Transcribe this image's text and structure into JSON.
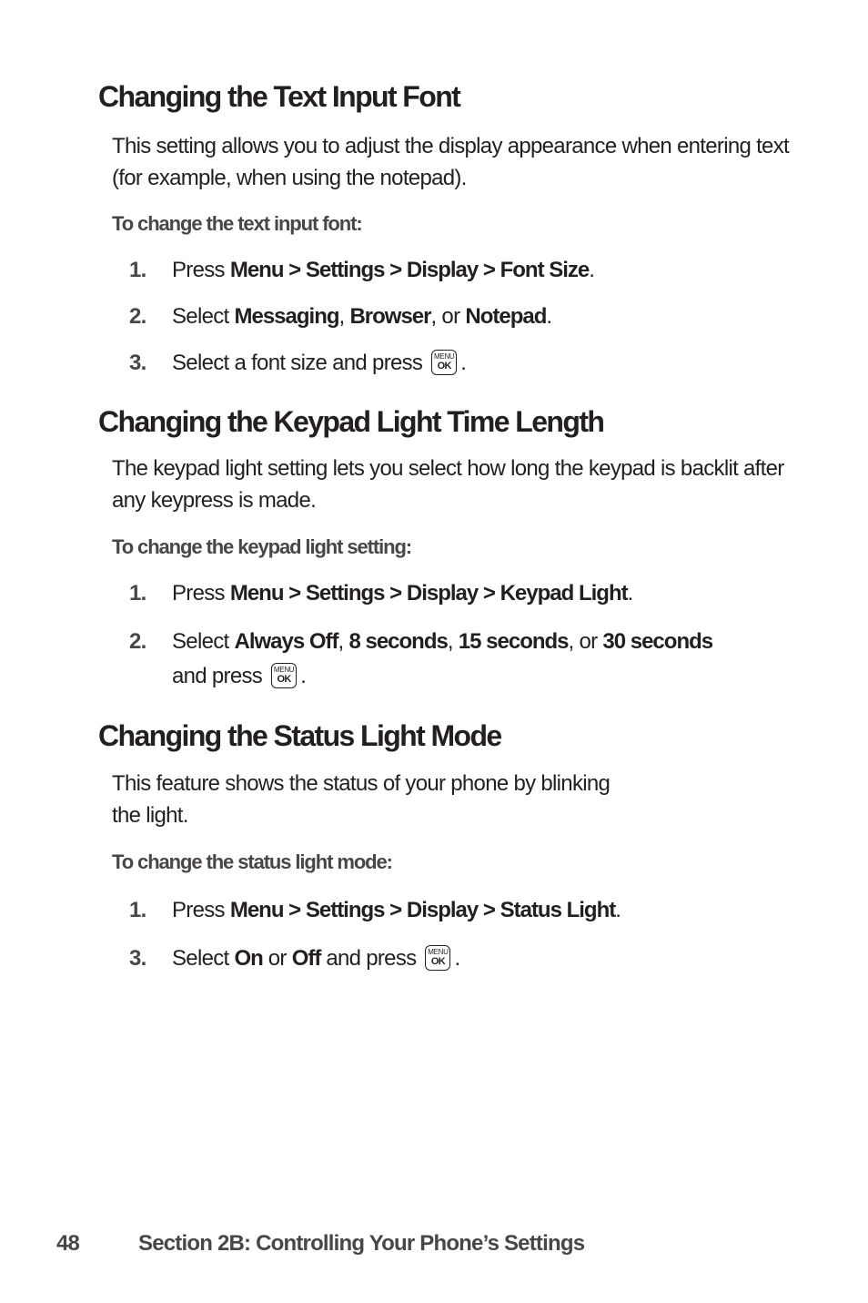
{
  "sections": [
    {
      "heading": "Changing the Text Input Font",
      "intro": "This setting allows you to adjust the display appearance when entering text (for example, when using the notepad).",
      "procedure_label": "To change the text input font:",
      "steps": [
        {
          "number": "1.",
          "parts": [
            "Press ",
            "Menu > Settings > Display > Font Size",
            "."
          ]
        },
        {
          "number": "2.",
          "parts": [
            "Select ",
            "Messaging",
            ", ",
            "Browser",
            ", or ",
            "Notepad",
            "."
          ]
        },
        {
          "number": "3.",
          "parts": [
            "Select a font size and press",
            "."
          ]
        }
      ]
    },
    {
      "heading": "Changing the Keypad Light Time Length",
      "intro": "The keypad light setting lets you select how long the keypad is backlit after any keypress is made.",
      "procedure_label": "To change the keypad light setting:",
      "steps": [
        {
          "number": "1.",
          "parts": [
            "Press ",
            "Menu > Settings > Display > Keypad Light",
            "."
          ]
        },
        {
          "number": "2.",
          "parts": [
            "Select ",
            "Always Off",
            ", ",
            "8 seconds",
            ", ",
            "15 seconds",
            ", or ",
            "30 seconds",
            " and press",
            "."
          ]
        }
      ]
    },
    {
      "heading": "Changing the Status Light Mode",
      "intro_line1": "This feature shows the status of your phone by blinking",
      "intro_line2": "the light.",
      "procedure_label": "To change the status light mode:",
      "steps": [
        {
          "number": "1.",
          "parts": [
            "Press ",
            "Menu > Settings > Display > Status Light",
            "."
          ]
        },
        {
          "number": "3.",
          "parts": [
            "Select ",
            "On",
            " or ",
            "Off",
            " and press",
            "."
          ]
        }
      ]
    }
  ],
  "key_icon": {
    "name": "menu-ok-key-icon",
    "top_label": "MENU",
    "bottom_label": "OK"
  },
  "footer": {
    "page_number": "48",
    "section_title": "Section 2B: Controlling Your Phone’s Settings"
  }
}
